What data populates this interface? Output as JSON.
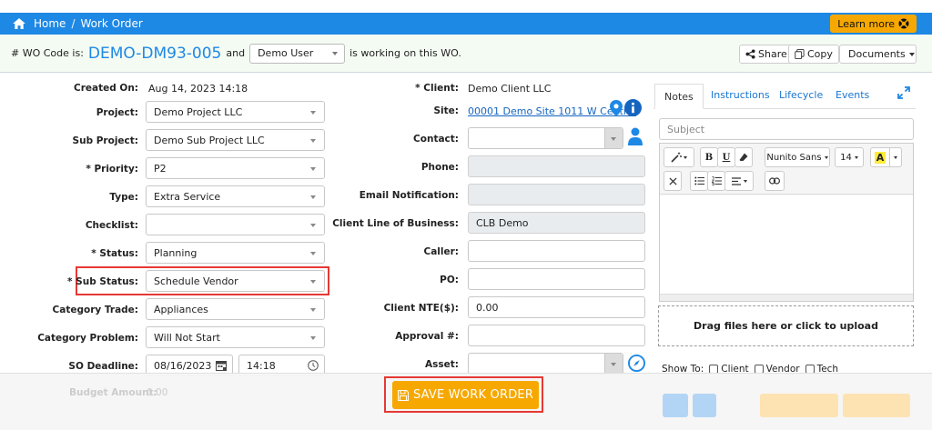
{
  "header": {
    "breadcrumb_home": "Home",
    "breadcrumb_sep": "/",
    "breadcrumb_current": "Work Order",
    "learn_more": "Learn more"
  },
  "wo": {
    "prefix": "# WO Code is:",
    "code": "DEMO-DM93-005",
    "and": "and",
    "user": "Demo User",
    "suffix": "is working on this WO.",
    "share": "Share",
    "copy": "Copy",
    "documents": "Documents"
  },
  "left_form": {
    "created_on_label": "Created On:",
    "created_on": "Aug 14, 2023 14:18",
    "project_label": "Project:",
    "project": "Demo Project LLC",
    "sub_project_label": "Sub Project:",
    "sub_project": "Demo Sub Project LLC",
    "priority_label": "* Priority:",
    "priority": "P2",
    "type_label": "Type:",
    "type": "Extra Service",
    "checklist_label": "Checklist:",
    "checklist": "",
    "status_label": "* Status:",
    "status": "Planning",
    "sub_status_label": "* Sub Status:",
    "sub_status": "Schedule Vendor",
    "category_trade_label": "Category Trade:",
    "category_trade": "Appliances",
    "category_problem_label": "Category Problem:",
    "category_problem": "Will Not Start",
    "so_deadline_label": "SO Deadline:",
    "so_deadline_date": "08/16/2023",
    "so_deadline_time": "14:18",
    "budget_label": "Budget Amount:",
    "budget": "0.00"
  },
  "mid_form": {
    "client_label": "* Client:",
    "client": "Demo Client LLC",
    "site_label": "Site:",
    "site": "00001 Demo Site 1011 W Centr...",
    "contact_label": "Contact:",
    "contact": "",
    "phone_label": "Phone:",
    "phone": "",
    "email_label": "Email Notification:",
    "email": "",
    "clb_label": "Client Line of Business:",
    "clb": "CLB Demo",
    "caller_label": "Caller:",
    "caller": "",
    "po_label": "PO:",
    "po": "",
    "nte_label": "Client NTE($):",
    "nte": "0.00",
    "approval_label": "Approval #:",
    "approval": "",
    "asset_label": "Asset:",
    "asset": ""
  },
  "panel": {
    "tabs": [
      "Notes",
      "Instructions",
      "Lifecycle",
      "Events"
    ],
    "subject_placeholder": "Subject",
    "font_name": "Nunito Sans",
    "font_size": "14",
    "drop_text": "Drag files here or click to upload",
    "show_to_label": "Show To:",
    "show_to_options": [
      "Client",
      "Vendor",
      "Tech"
    ]
  },
  "footer": {
    "save": "SAVE WORK ORDER"
  },
  "colors": {
    "primary": "#1e88e5",
    "accent": "#f6a800",
    "highlight": "#e53935"
  }
}
